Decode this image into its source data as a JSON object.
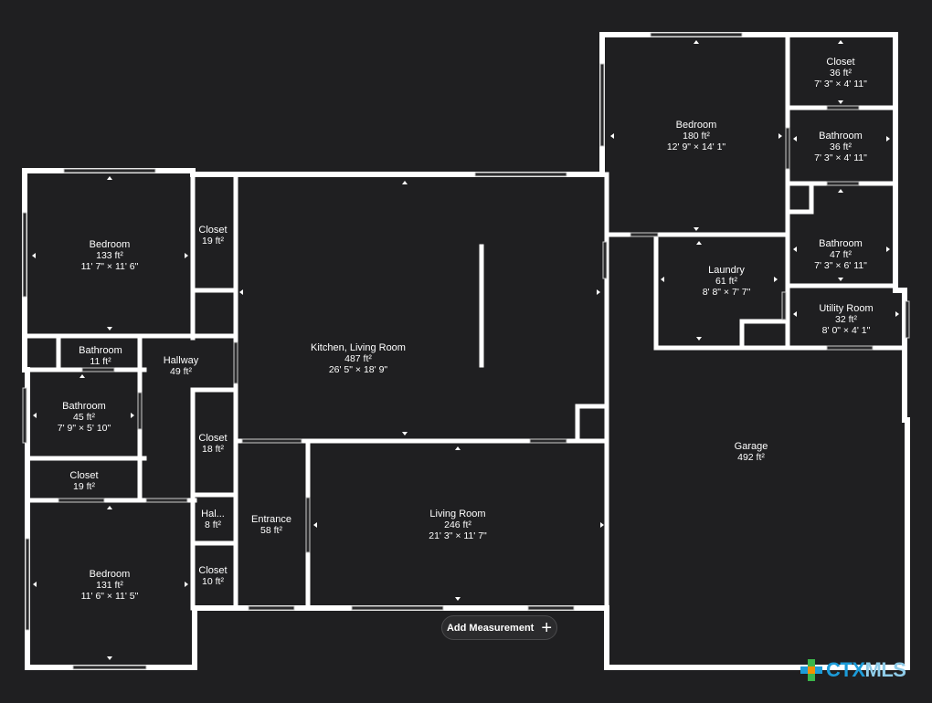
{
  "rooms": [
    {
      "id": "bedroom-nw",
      "name": "Bedroom",
      "area": "133 ft²",
      "dims": "11' 7\" × 11' 6\""
    },
    {
      "id": "closet-nw",
      "name": "Closet",
      "area": "19 ft²",
      "dims": ""
    },
    {
      "id": "bathroom-small",
      "name": "Bathroom",
      "area": "11 ft²",
      "dims": ""
    },
    {
      "id": "hallway",
      "name": "Hallway",
      "area": "49 ft²",
      "dims": ""
    },
    {
      "id": "bathroom-w",
      "name": "Bathroom",
      "area": "45 ft²",
      "dims": "7' 9\" × 5' 10\""
    },
    {
      "id": "closet-w",
      "name": "Closet",
      "area": "19 ft²",
      "dims": ""
    },
    {
      "id": "closet-mid",
      "name": "Closet",
      "area": "18 ft²",
      "dims": ""
    },
    {
      "id": "hall-small",
      "name": "Hal...",
      "area": "8 ft²",
      "dims": ""
    },
    {
      "id": "bedroom-sw",
      "name": "Bedroom",
      "area": "131 ft²",
      "dims": "11' 6\" × 11' 5\""
    },
    {
      "id": "closet-sw",
      "name": "Closet",
      "area": "10 ft²",
      "dims": ""
    },
    {
      "id": "entrance",
      "name": "Entrance",
      "area": "58 ft²",
      "dims": ""
    },
    {
      "id": "kitchen-living",
      "name": "Kitchen, Living Room",
      "area": "487 ft²",
      "dims": "26' 5\" × 18' 9\""
    },
    {
      "id": "living-room",
      "name": "Living Room",
      "area": "246 ft²",
      "dims": "21' 3\" × 11' 7\""
    },
    {
      "id": "bedroom-ne",
      "name": "Bedroom",
      "area": "180 ft²",
      "dims": "12' 9\" × 14' 1\""
    },
    {
      "id": "closet-ne",
      "name": "Closet",
      "area": "36 ft²",
      "dims": "7' 3\" × 4' 11\""
    },
    {
      "id": "bathroom-ne",
      "name": "Bathroom",
      "area": "36 ft²",
      "dims": "7' 3\" × 4' 11\""
    },
    {
      "id": "bathroom-e",
      "name": "Bathroom",
      "area": "47 ft²",
      "dims": "7' 3\" × 6' 11\""
    },
    {
      "id": "laundry",
      "name": "Laundry",
      "area": "61 ft²",
      "dims": "8' 8\" × 7' 7\""
    },
    {
      "id": "utility",
      "name": "Utility Room",
      "area": "32 ft²",
      "dims": "8' 0\" × 4' 1\""
    },
    {
      "id": "garage",
      "name": "Garage",
      "area": "492 ft²",
      "dims": ""
    }
  ],
  "add_measurement_label": "Add Measurement",
  "logo": {
    "text": "CTX",
    "suffix": "MLS"
  },
  "colors": {
    "background": "#1f1f21",
    "wall": "#ffffff",
    "logo_blue": "#1c9bd8",
    "logo_green": "#3bb54a",
    "logo_orange": "#f39200"
  }
}
